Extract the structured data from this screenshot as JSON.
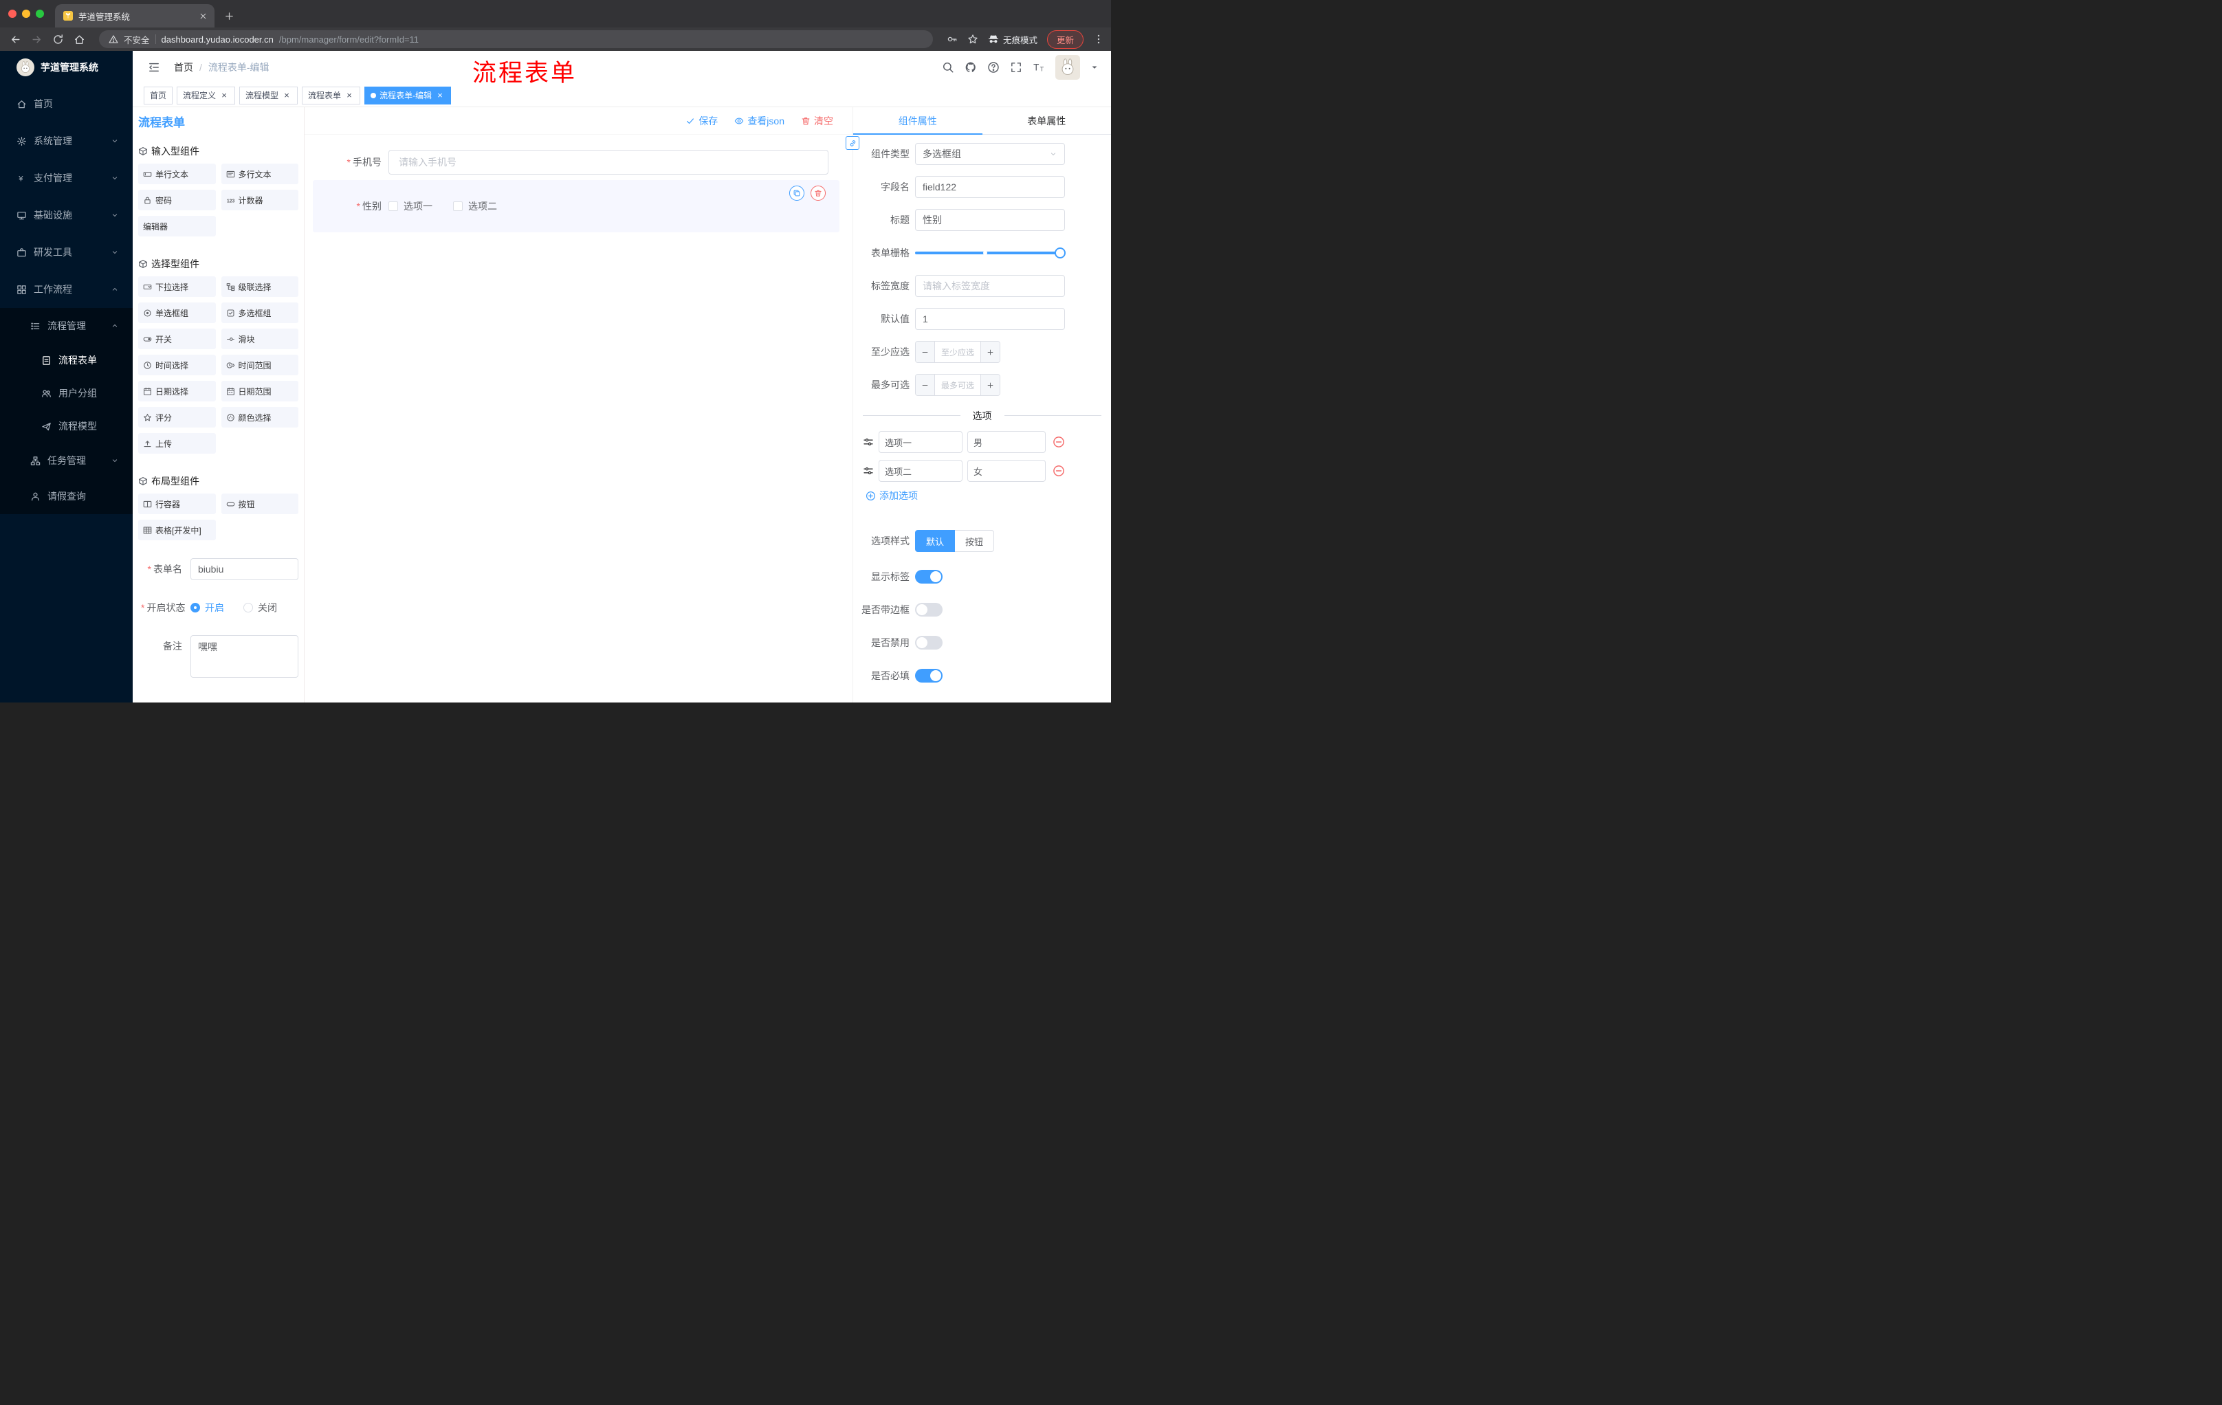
{
  "colors": {
    "accent": "#409eff",
    "danger": "#f56c6c",
    "sidebar_bg": "#001529",
    "submenu_bg": "#000c17",
    "overlay_red": "#ff0000",
    "tag_active": "#409eff"
  },
  "browser": {
    "tab_title": "芋道管理系统",
    "security_label": "不安全",
    "url_domain": "dashboard.yudao.iocoder.cn",
    "url_path": "/bpm/manager/form/edit?formId=11",
    "incognito_label": "无痕模式",
    "update_label": "更新"
  },
  "sidebar": {
    "logo_title": "芋道管理系统",
    "items": [
      {
        "label": "首页",
        "icon": "home-icon",
        "level": 0
      },
      {
        "label": "系统管理",
        "icon": "gear-icon",
        "level": 0,
        "chevron": "down"
      },
      {
        "label": "支付管理",
        "icon": "yen-icon",
        "level": 0,
        "chevron": "down"
      },
      {
        "label": "基础设施",
        "icon": "infra-icon",
        "level": 0,
        "chevron": "down"
      },
      {
        "label": "研发工具",
        "icon": "tools-icon",
        "level": 0,
        "chevron": "down"
      },
      {
        "label": "工作流程",
        "icon": "workflow-icon",
        "level": 0,
        "chevron": "up"
      },
      {
        "label": "流程管理",
        "icon": "list-icon",
        "level": 1,
        "chevron": "up"
      },
      {
        "label": "流程表单",
        "icon": "form-icon",
        "level": 2,
        "active": true
      },
      {
        "label": "用户分组",
        "icon": "users-icon",
        "level": 2
      },
      {
        "label": "流程模型",
        "icon": "send-icon",
        "level": 2
      },
      {
        "label": "任务管理",
        "icon": "tree-icon",
        "level": 1,
        "chevron": "down"
      },
      {
        "label": "请假查询",
        "icon": "user-icon",
        "level": 1
      }
    ]
  },
  "header": {
    "breadcrumb": [
      "首页",
      "流程表单-编辑"
    ],
    "overlay_title": "流程表单"
  },
  "tags": [
    {
      "label": "首页"
    },
    {
      "label": "流程定义",
      "closable": true
    },
    {
      "label": "流程模型",
      "closable": true
    },
    {
      "label": "流程表单",
      "closable": true
    },
    {
      "label": "流程表单-编辑",
      "closable": true,
      "active": true
    }
  ],
  "designer": {
    "title": "流程表单",
    "sections": [
      {
        "title": "输入型组件",
        "items": [
          {
            "label": "单行文本",
            "icon": "input-icon"
          },
          {
            "label": "多行文本",
            "icon": "textarea-icon"
          },
          {
            "label": "密码",
            "icon": "lock-icon"
          },
          {
            "label": "计数器",
            "icon": "counter-icon"
          },
          {
            "label": "编辑器"
          }
        ]
      },
      {
        "title": "选择型组件",
        "items": [
          {
            "label": "下拉选择",
            "icon": "select-icon"
          },
          {
            "label": "级联选择",
            "icon": "cascade-icon"
          },
          {
            "label": "单选框组",
            "icon": "radio-icon"
          },
          {
            "label": "多选框组",
            "icon": "checkbox-icon"
          },
          {
            "label": "开关",
            "icon": "switch-icon"
          },
          {
            "label": "滑块",
            "icon": "slider-icon"
          },
          {
            "label": "时间选择",
            "icon": "time-icon"
          },
          {
            "label": "时间范围",
            "icon": "time-range-icon"
          },
          {
            "label": "日期选择",
            "icon": "date-icon"
          },
          {
            "label": "日期范围",
            "icon": "date-range-icon"
          },
          {
            "label": "评分",
            "icon": "rate-icon"
          },
          {
            "label": "颜色选择",
            "icon": "color-icon"
          },
          {
            "label": "上传",
            "icon": "upload-icon"
          }
        ]
      },
      {
        "title": "布局型组件",
        "items": [
          {
            "label": "行容器",
            "icon": "row-icon"
          },
          {
            "label": "按钮",
            "icon": "button-icon"
          },
          {
            "label": "表格[开发中]",
            "icon": "table-icon"
          }
        ]
      }
    ],
    "form": {
      "name_label": "表单名",
      "name_value": "biubiu",
      "status_label": "开启状态",
      "status_on": "开启",
      "status_off": "关闭",
      "remark_label": "备注",
      "remark_value": "嘿嘿"
    }
  },
  "canvas": {
    "actions": {
      "save": "保存",
      "view_json": "查看json",
      "clear": "清空"
    },
    "phone": {
      "label": "手机号",
      "placeholder": "请输入手机号"
    },
    "gender": {
      "label": "性别",
      "options": [
        "选项一",
        "选项二"
      ]
    }
  },
  "properties": {
    "tabs": [
      "组件属性",
      "表单属性"
    ],
    "component_type": {
      "label": "组件类型",
      "value": "多选框组"
    },
    "field_name": {
      "label": "字段名",
      "value": "field122"
    },
    "title": {
      "label": "标题",
      "value": "性别"
    },
    "grid": {
      "label": "表单栅格"
    },
    "label_width": {
      "label": "标签宽度",
      "placeholder": "请输入标签宽度"
    },
    "default_value": {
      "label": "默认值",
      "value": "1"
    },
    "min_select": {
      "label": "至少应选",
      "placeholder": "至少应选"
    },
    "max_select": {
      "label": "最多可选",
      "placeholder": "最多可选"
    },
    "options_divider": "选项",
    "options": [
      {
        "name": "选项一",
        "value": "男"
      },
      {
        "name": "选项二",
        "value": "女"
      }
    ],
    "add_option": "添加选项",
    "option_style": {
      "label": "选项样式",
      "choices": [
        "默认",
        "按钮"
      ],
      "selected": "默认"
    },
    "switches": [
      {
        "label": "显示标签",
        "on": true
      },
      {
        "label": "是否带边框",
        "on": false
      },
      {
        "label": "是否禁用",
        "on": false
      },
      {
        "label": "是否必填",
        "on": true
      }
    ]
  }
}
